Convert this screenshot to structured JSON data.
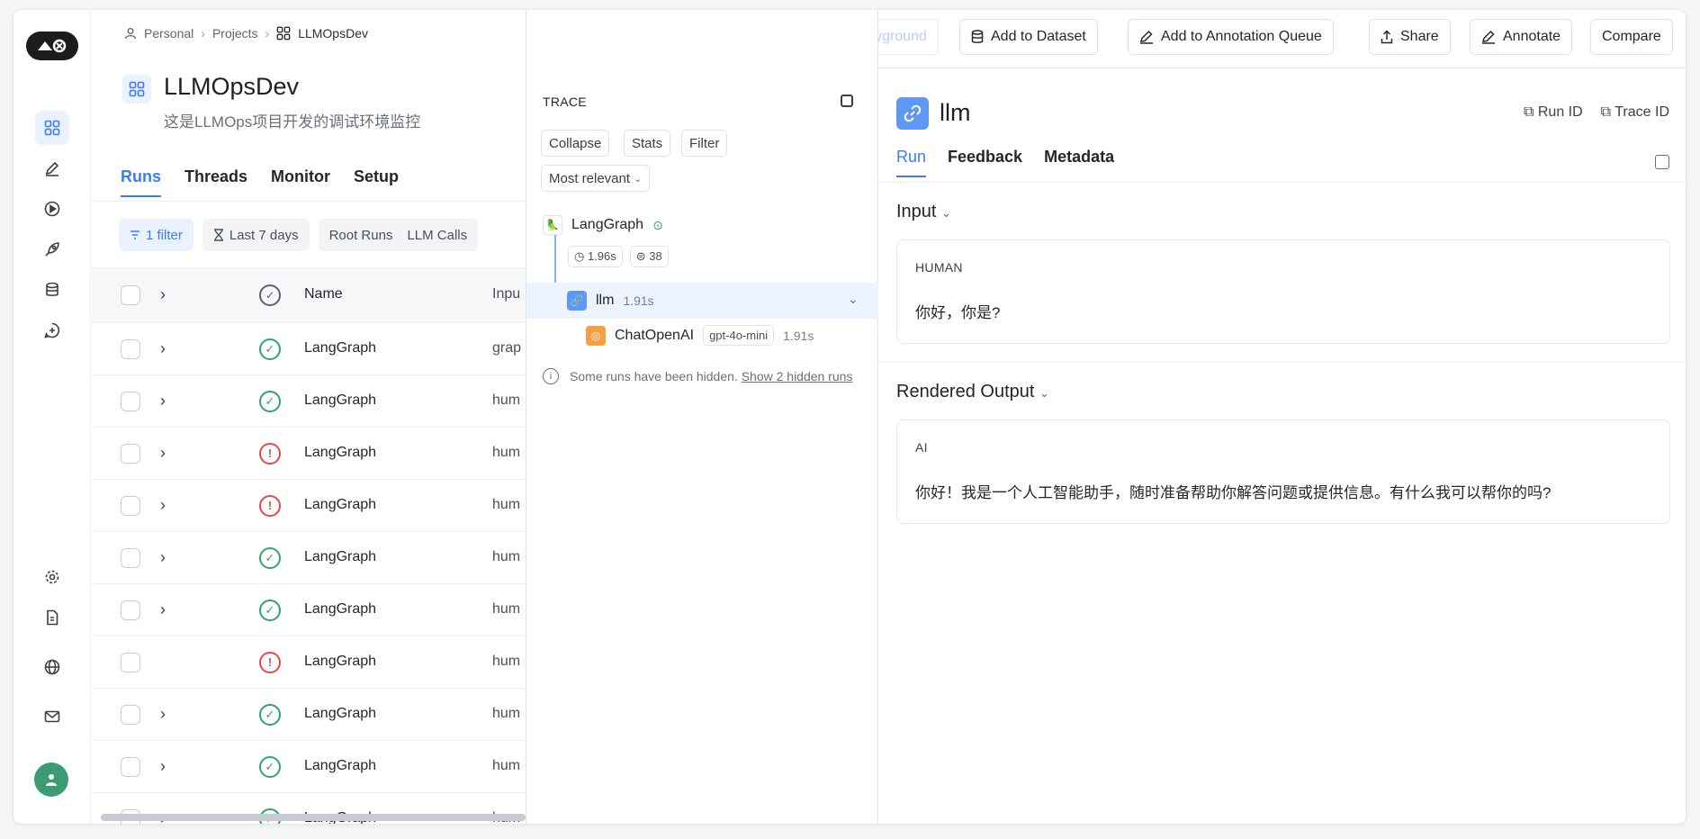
{
  "rail": {
    "logo": "🧹⚒"
  },
  "breadcrumb": {
    "items": [
      "Personal",
      "Projects",
      "LLMOpsDev"
    ]
  },
  "project": {
    "title": "LLMOpsDev",
    "description": "这是LLMOps项目开发的调试环境监控"
  },
  "tabs": [
    "Runs",
    "Threads",
    "Monitor",
    "Setup"
  ],
  "filters": {
    "filter_chip": "1 filter",
    "date_chip": "Last 7 days",
    "root_runs": "Root Runs",
    "llm_calls": "LLM Calls"
  },
  "table": {
    "columns": [
      "Name",
      "Inpu"
    ],
    "rows": [
      {
        "name": "LangGraph",
        "input": "grap",
        "status": "ok"
      },
      {
        "name": "LangGraph",
        "input": "hum",
        "status": "ok"
      },
      {
        "name": "LangGraph",
        "input": "hum",
        "status": "err"
      },
      {
        "name": "LangGraph",
        "input": "hum",
        "status": "err"
      },
      {
        "name": "LangGraph",
        "input": "hum",
        "status": "ok"
      },
      {
        "name": "LangGraph",
        "input": "hum",
        "status": "ok"
      },
      {
        "name": "LangGraph",
        "input": "hum",
        "status": "err"
      },
      {
        "name": "LangGraph",
        "input": "hum",
        "status": "ok"
      },
      {
        "name": "LangGraph",
        "input": "hum",
        "status": "ok"
      },
      {
        "name": "LangGraph",
        "input": "hum",
        "status": "ok"
      }
    ]
  },
  "toolbar": {
    "playground": "Playground",
    "add_dataset": "Add to Dataset",
    "add_queue": "Add to Annotation Queue",
    "share": "Share",
    "annotate": "Annotate",
    "compare": "Compare"
  },
  "trace": {
    "label": "TRACE",
    "collapse": "Collapse",
    "stats": "Stats",
    "filter": "Filter",
    "sort": "Most relevant",
    "root": {
      "name": "LangGraph",
      "latency": "1.96s",
      "tokens": "38"
    },
    "child": {
      "name": "llm",
      "latency": "1.91s"
    },
    "grandchild": {
      "name": "ChatOpenAI",
      "model": "gpt-4o-mini",
      "latency": "1.91s"
    },
    "hidden_text": "Some runs have been hidden.",
    "hidden_link": "Show 2 hidden runs"
  },
  "detail": {
    "title": "llm",
    "run_id": "Run ID",
    "trace_id": "Trace ID",
    "tabs": [
      "Run",
      "Feedback",
      "Metadata"
    ],
    "input_title": "Input",
    "input_role": "HUMAN",
    "input_msg": "你好，你是?",
    "output_title": "Rendered Output",
    "output_role": "AI",
    "output_msg": "你好！我是一个人工智能助手，随时准备帮助你解答问题或提供信息。有什么我可以帮你的吗?"
  },
  "colors": {
    "accent": "#3d7bf7",
    "ok": "#2fa56a",
    "error": "#e5484d",
    "avatar": "#3a9b74"
  }
}
